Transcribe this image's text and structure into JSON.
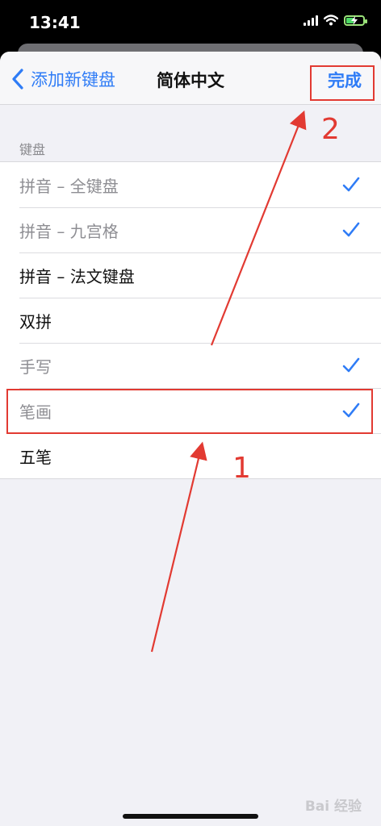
{
  "status_bar": {
    "time": "13:41"
  },
  "nav": {
    "back_label": "添加新键盘",
    "title": "简体中文",
    "done_label": "完成"
  },
  "section": {
    "header": "键盘"
  },
  "keyboards": [
    {
      "label": "拼音 – 全键盘",
      "checked": true
    },
    {
      "label": "拼音 – 九宫格",
      "checked": true
    },
    {
      "label": "拼音 – 法文键盘",
      "checked": false
    },
    {
      "label": "双拼",
      "checked": false
    },
    {
      "label": "手写",
      "checked": true
    },
    {
      "label": "笔画",
      "checked": true
    },
    {
      "label": "五笔",
      "checked": false
    }
  ],
  "annotations": {
    "step1": "1",
    "step2": "2"
  },
  "colors": {
    "accent": "#2f7cf6",
    "annotation_red": "#e23a32",
    "background": "#f1f1f6"
  },
  "watermark": "Bai 经验"
}
